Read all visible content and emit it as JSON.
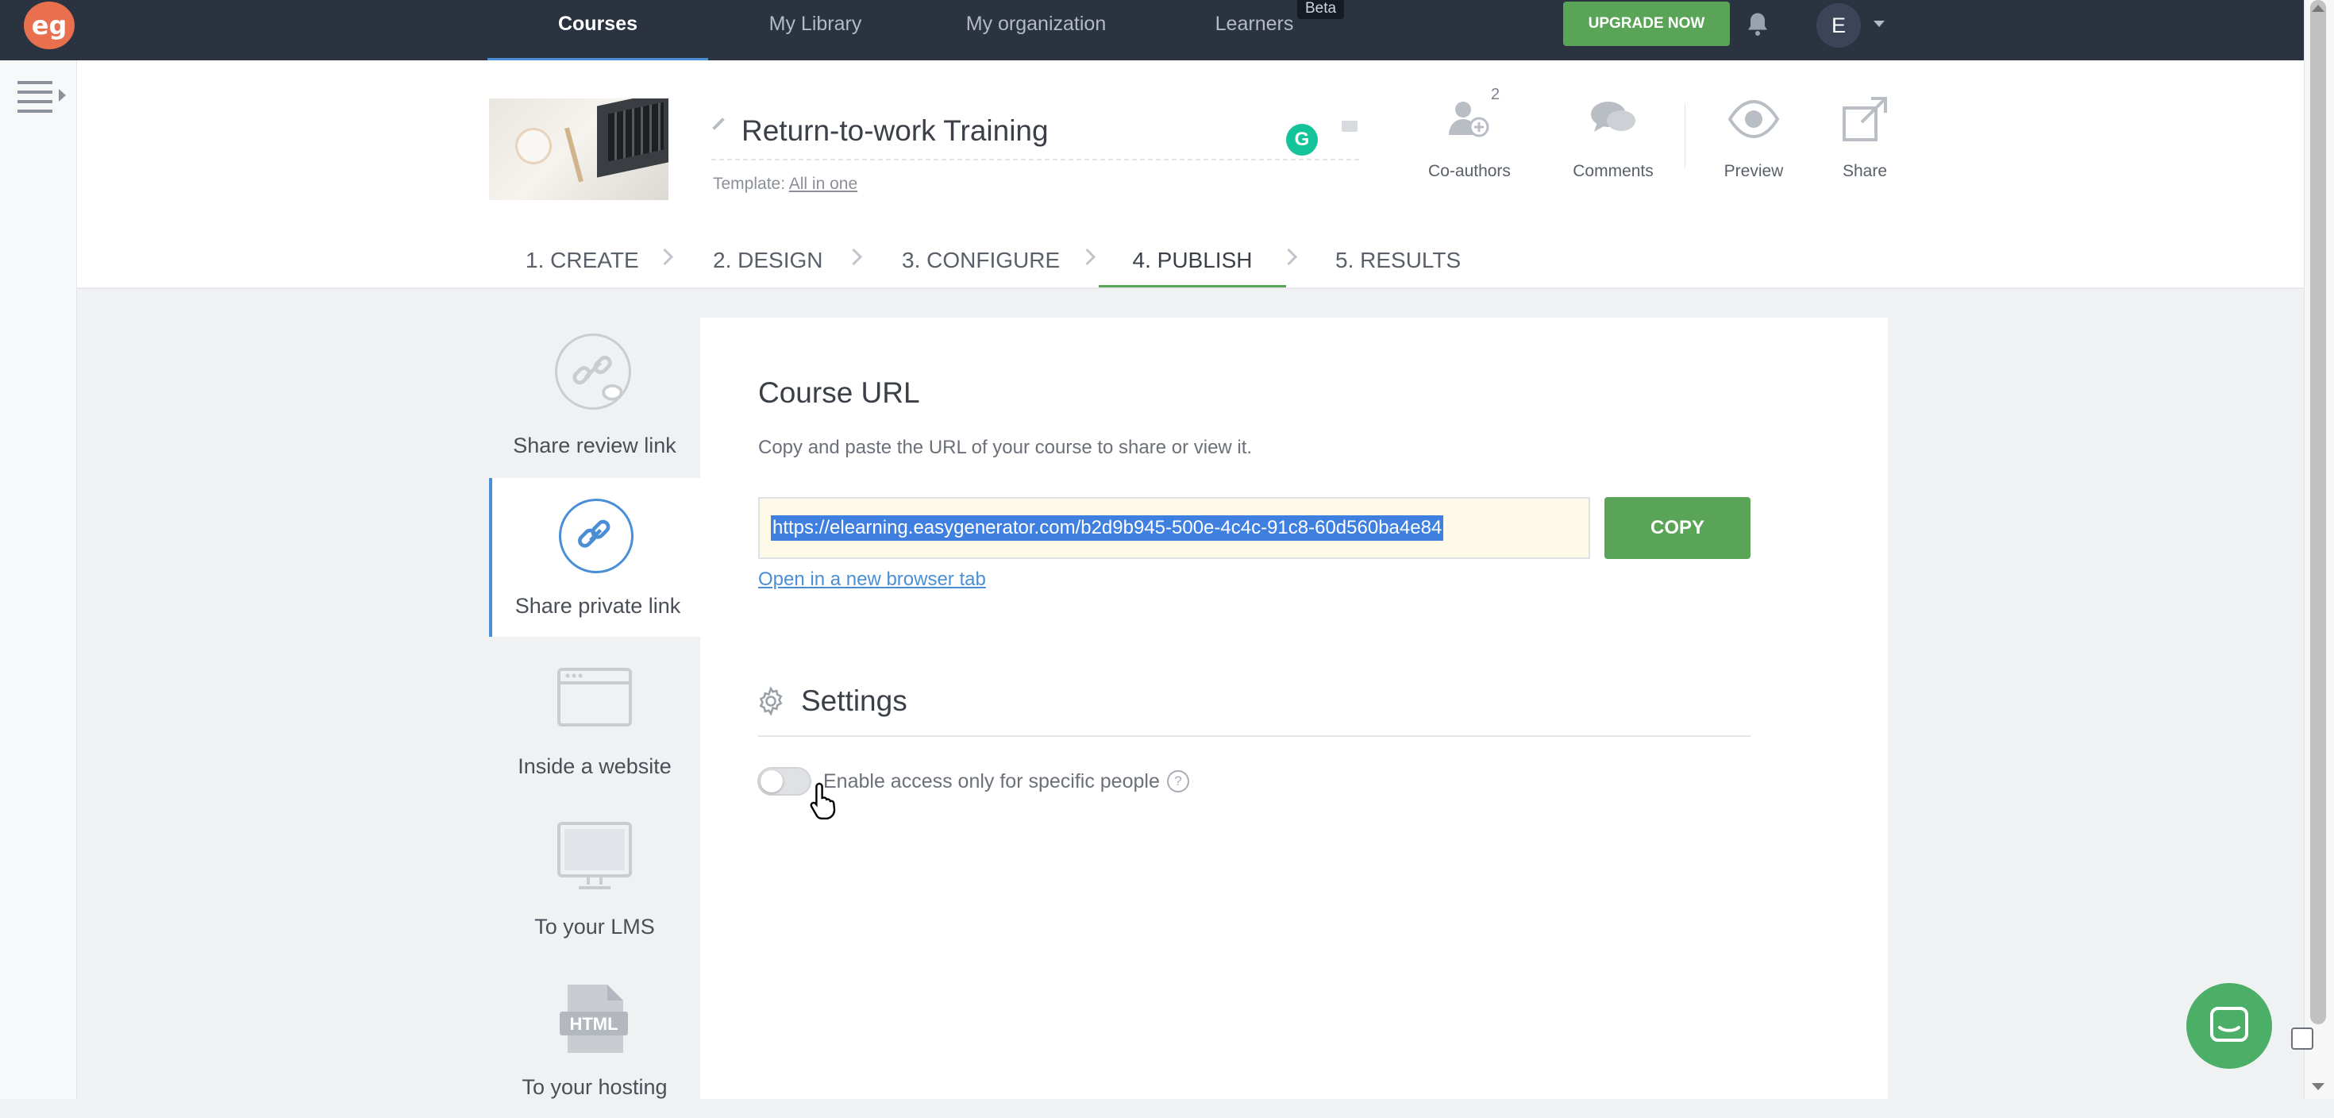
{
  "topbar": {
    "logo": "eg",
    "nav": [
      "Courses",
      "My Library",
      "My organization",
      "Learners"
    ],
    "beta_badge": "Beta",
    "upgrade_label": "UPGRADE NOW",
    "avatar_initial": "E"
  },
  "course": {
    "title": "Return-to-work Training",
    "template_label": "Template:",
    "template_value": "All in one"
  },
  "header_actions": {
    "coauthors": "Co-authors",
    "coauthors_count": "2",
    "comments": "Comments",
    "preview": "Preview",
    "share": "Share"
  },
  "tabs": [
    "1. CREATE",
    "2. DESIGN",
    "3. CONFIGURE",
    "4. PUBLISH",
    "5. RESULTS"
  ],
  "publish_menu": [
    "Share review link",
    "Share private link",
    "Inside a website",
    "To your LMS",
    "To your hosting"
  ],
  "course_url": {
    "heading": "Course URL",
    "description": "Copy and paste the URL of your course to share or view it.",
    "url": "https://elearning.easygenerator.com/b2d9b945-500e-4c4c-91c8-60d560ba4e84",
    "copy_label": "COPY",
    "open_link": "Open in a new browser tab"
  },
  "settings": {
    "heading": "Settings",
    "toggle_label": "Enable access only for specific people",
    "help": "?"
  },
  "colors": {
    "topbar": "#2b3240",
    "accent_green": "#5aa457",
    "accent_blue": "#4a8fd6",
    "logo": "#e8704e"
  }
}
